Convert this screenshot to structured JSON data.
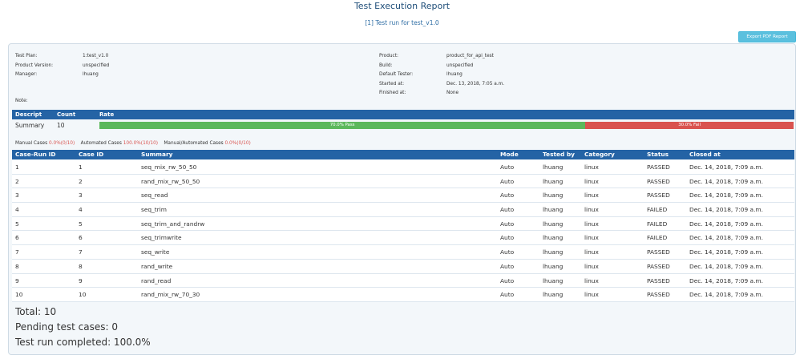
{
  "header": {
    "title": "Test Execution Report",
    "run_link": "[1] Test run for test_v1.0",
    "export_label": "Export PDF Report"
  },
  "info_left": [
    {
      "label": "Test Plan:",
      "value": "1:test_v1.0"
    },
    {
      "label": "Product Version:",
      "value": "unspecified"
    },
    {
      "label": "Manager:",
      "value": "lhuang"
    }
  ],
  "info_right": [
    {
      "label": "Product:",
      "value": "product_for_api_test"
    },
    {
      "label": "Build:",
      "value": "unspecified"
    },
    {
      "label": "Default Tester:",
      "value": "lhuang"
    },
    {
      "label": "Started at:",
      "value": "Dec. 13, 2018, 7:05 a.m."
    },
    {
      "label": "Finished at:",
      "value": "None"
    }
  ],
  "note_label": "Note:",
  "summary": {
    "headers": {
      "descript": "Descript",
      "count": "Count",
      "rate": "Rate"
    },
    "row": {
      "descript": "Summary",
      "count": "10"
    },
    "pass_fraction": 0.7,
    "pass_label": "70.0% Pass",
    "fail_label": "30.0% Fail",
    "pass_color": "#5cb85c",
    "fail_color": "#d9534f"
  },
  "case_stats": {
    "manual_label": "Manual Cases",
    "manual_value": "0.0%(0/10)",
    "automated_label": "Automated Cases",
    "automated_value": "100.0%(10/10)",
    "mixed_label": "Manual/Automated Cases",
    "mixed_value": "0.0%(0/10)"
  },
  "table": {
    "columns": [
      "Case-Run ID",
      "Case ID",
      "Summary",
      "Mode",
      "Tested by",
      "Category",
      "Status",
      "Closed at"
    ],
    "rows": [
      [
        "1",
        "1",
        "seq_mix_rw_50_50",
        "Auto",
        "lhuang",
        "linux",
        "PASSED",
        "Dec. 14, 2018, 7:09 a.m."
      ],
      [
        "2",
        "2",
        "rand_mix_rw_50_50",
        "Auto",
        "lhuang",
        "linux",
        "PASSED",
        "Dec. 14, 2018, 7:09 a.m."
      ],
      [
        "3",
        "3",
        "seq_read",
        "Auto",
        "lhuang",
        "linux",
        "PASSED",
        "Dec. 14, 2018, 7:09 a.m."
      ],
      [
        "4",
        "4",
        "seq_trim",
        "Auto",
        "lhuang",
        "linux",
        "FAILED",
        "Dec. 14, 2018, 7:09 a.m."
      ],
      [
        "5",
        "5",
        "seq_trim_and_randrw",
        "Auto",
        "lhuang",
        "linux",
        "FAILED",
        "Dec. 14, 2018, 7:09 a.m."
      ],
      [
        "6",
        "6",
        "seq_trimwrite",
        "Auto",
        "lhuang",
        "linux",
        "FAILED",
        "Dec. 14, 2018, 7:09 a.m."
      ],
      [
        "7",
        "7",
        "seq_write",
        "Auto",
        "lhuang",
        "linux",
        "PASSED",
        "Dec. 14, 2018, 7:09 a.m."
      ],
      [
        "8",
        "8",
        "rand_write",
        "Auto",
        "lhuang",
        "linux",
        "PASSED",
        "Dec. 14, 2018, 7:09 a.m."
      ],
      [
        "9",
        "9",
        "rand_read",
        "Auto",
        "lhuang",
        "linux",
        "PASSED",
        "Dec. 14, 2018, 7:09 a.m."
      ],
      [
        "10",
        "10",
        "rand_mix_rw_70_30",
        "Auto",
        "lhuang",
        "linux",
        "PASSED",
        "Dec. 14, 2018, 7:09 a.m."
      ]
    ]
  },
  "totals": {
    "total": "Total: 10",
    "pending": "Pending test cases: 0",
    "completed": "Test run completed: 100.0%"
  }
}
